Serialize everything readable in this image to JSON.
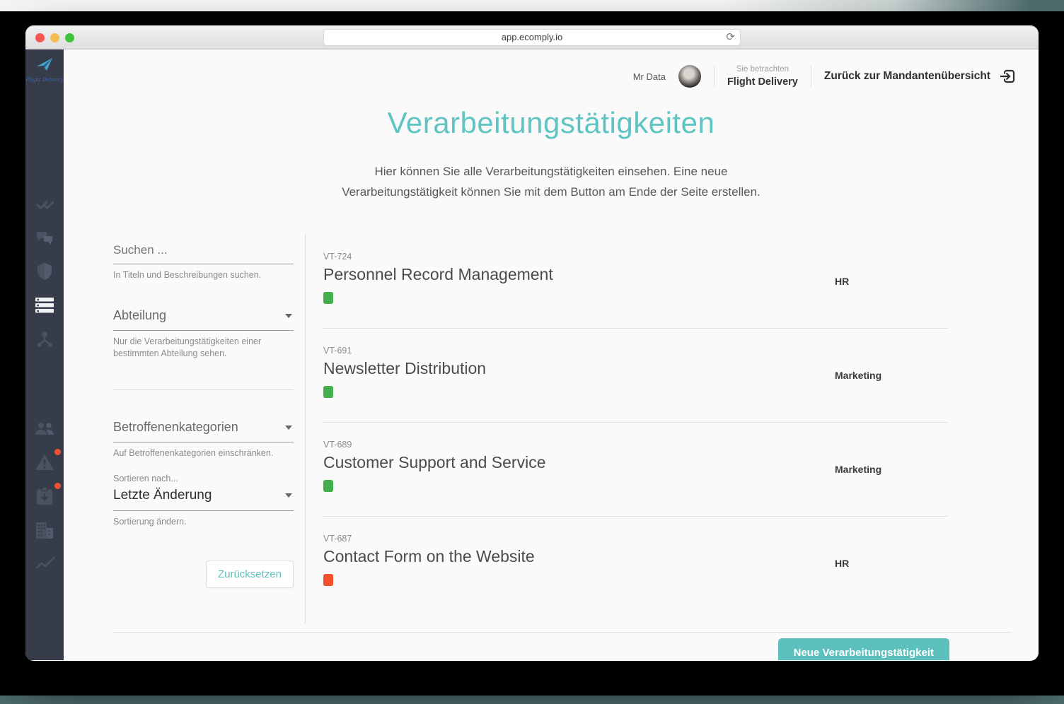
{
  "browser": {
    "url": "app.ecomply.io",
    "refresh_icon": "⟳",
    "traffic_lights": {
      "close": "#f6574e",
      "minimize": "#f5bd4f",
      "maximize": "#3fc23c"
    }
  },
  "sidebar": {
    "logo_text": "Flight Delivery",
    "icons": [
      {
        "name": "double-check-icon",
        "active": false,
        "badge": false
      },
      {
        "name": "chat-icon",
        "active": false,
        "badge": false
      },
      {
        "name": "shield-icon",
        "active": false,
        "badge": false
      },
      {
        "name": "list-icon",
        "active": true,
        "badge": false
      },
      {
        "name": "network-icon",
        "active": false,
        "badge": false
      },
      {
        "name": "people-icon",
        "active": false,
        "badge": true
      },
      {
        "name": "warning-icon",
        "active": false,
        "badge": true
      },
      {
        "name": "inbox-download-icon",
        "active": false,
        "badge": false
      },
      {
        "name": "building-icon",
        "active": false,
        "badge": false
      },
      {
        "name": "trend-icon",
        "active": false,
        "badge": false
      }
    ],
    "badge_color": "#f4502e"
  },
  "header": {
    "user_name": "Mr Data",
    "viewing_label": "Sie betrachten",
    "tenant_name": "Flight Delivery",
    "back_link": "Zurück zur Mandantenübersicht"
  },
  "page": {
    "title": "Verarbeitungstätigkeiten",
    "subtitle_line1": "Hier können Sie alle Verarbeitungstätigkeiten einsehen. Eine neue",
    "subtitle_line2": "Verarbeitungstätigkeit können Sie mit dem Button am Ende der Seite erstellen."
  },
  "filters": {
    "search_placeholder": "Suchen ...",
    "search_help": "In Titeln und Beschreibungen suchen.",
    "department_label": "Abteilung",
    "department_help": "Nur die Verarbeitungstätigkeiten einer bestimmten Abteilung sehen.",
    "categories_label": "Betroffenenkategorien",
    "categories_help": "Auf Betroffenenkategorien einschränken.",
    "sort_label": "Sortieren nach...",
    "sort_value": "Letzte Änderung",
    "sort_help": "Sortierung ändern.",
    "reset_button": "Zurücksetzen"
  },
  "list": {
    "items": [
      {
        "code": "VT-724",
        "title": "Personnel Record Management",
        "status_color": "#44ad4c",
        "department": "HR"
      },
      {
        "code": "VT-691",
        "title": "Newsletter Distribution",
        "status_color": "#44ad4c",
        "department": "Marketing"
      },
      {
        "code": "VT-689",
        "title": "Customer Support and Service",
        "status_color": "#44ad4c",
        "department": "Marketing"
      },
      {
        "code": "VT-687",
        "title": "Contact Form on the Website",
        "status_color": "#f4502e",
        "department": "HR"
      }
    ]
  },
  "footer": {
    "new_button": "Neue Verarbeitungstätigkeit"
  },
  "colors": {
    "accent_teal": "#5cc0bd",
    "title_teal": "#60c5c2",
    "sidebar_bg": "#363c49",
    "status_green": "#44ad4c",
    "status_red": "#f4502e"
  }
}
